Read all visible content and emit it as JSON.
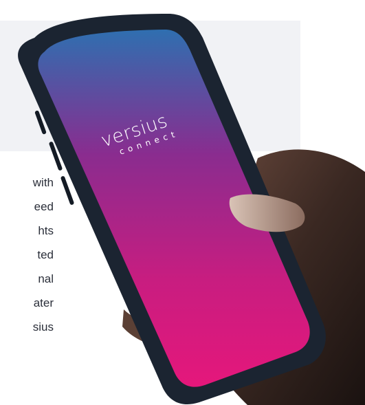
{
  "body_text": {
    "lines": [
      "with",
      "eed",
      "hts",
      "ted",
      "nal",
      "ater",
      "sius"
    ]
  },
  "logo": {
    "word": "versius",
    "sub": "connect"
  },
  "colors": {
    "panel": "#f1f2f5",
    "text": "#2b2f3a",
    "phone_case": "#1b2431",
    "screen_top": "#2f6fb0",
    "screen_mid": "#8a2c8f",
    "screen_bottom": "#e5177b"
  }
}
